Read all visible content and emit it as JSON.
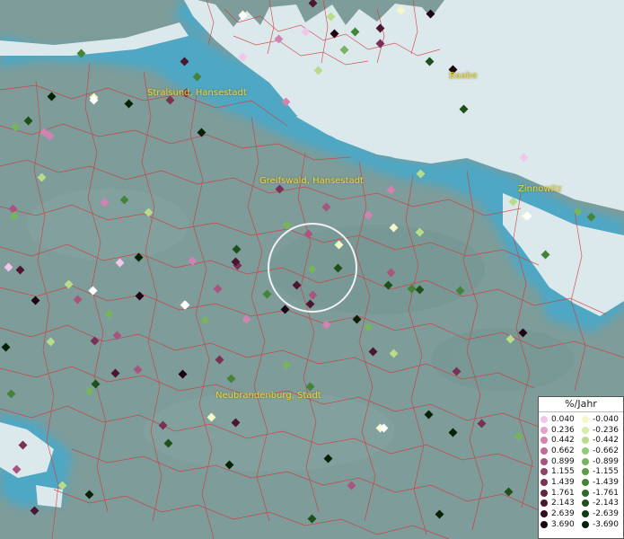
{
  "map": {
    "place_labels": [
      {
        "name": "Stralsund, Hansestadt",
        "slot": "stralsund"
      },
      {
        "name": "Greifswald, Hansestadt",
        "slot": "greifswald"
      },
      {
        "name": "Zinnowitz",
        "slot": "zinnowitz"
      },
      {
        "name": "Baabe",
        "slot": "baabe"
      },
      {
        "name": "Neubrandenburg, Stadt",
        "slot": "neubrandenburg"
      }
    ],
    "colors": {
      "land": "#7d9c9a",
      "water": "#dce9ec",
      "coast_glow": "#4aa9c9",
      "borders": "#d23a3a",
      "focus_ring": "#f2f2f2"
    }
  },
  "legend": {
    "title": "%/Jahr",
    "positive": [
      {
        "label": "0.040",
        "color": "#f2c6ea"
      },
      {
        "label": "0.236",
        "color": "#e3a2cf"
      },
      {
        "label": "0.442",
        "color": "#d283b2"
      },
      {
        "label": "0.662",
        "color": "#c06a98"
      },
      {
        "label": "0.899",
        "color": "#a8547f"
      },
      {
        "label": "1.155",
        "color": "#914269"
      },
      {
        "label": "1.439",
        "color": "#793155"
      },
      {
        "label": "1.761",
        "color": "#622342"
      },
      {
        "label": "2.143",
        "color": "#4a1630"
      },
      {
        "label": "2.639",
        "color": "#320b1f"
      },
      {
        "label": "3.690",
        "color": "#1e0412"
      }
    ],
    "negative": [
      {
        "label": "-0.040",
        "color": "#f4f8c8"
      },
      {
        "label": "-0.236",
        "color": "#d8edaa"
      },
      {
        "label": "-0.442",
        "color": "#b8dc8c"
      },
      {
        "label": "-0.662",
        "color": "#98c977"
      },
      {
        "label": "-0.899",
        "color": "#78b460"
      },
      {
        "label": "-1.155",
        "color": "#5c9d4a"
      },
      {
        "label": "-1.439",
        "color": "#448437"
      },
      {
        "label": "-1.761",
        "color": "#2f6a27"
      },
      {
        "label": "-2.143",
        "color": "#1e511a"
      },
      {
        "label": "-2.639",
        "color": "#103a0f"
      },
      {
        "label": "-3.690",
        "color": "#052206"
      }
    ]
  }
}
